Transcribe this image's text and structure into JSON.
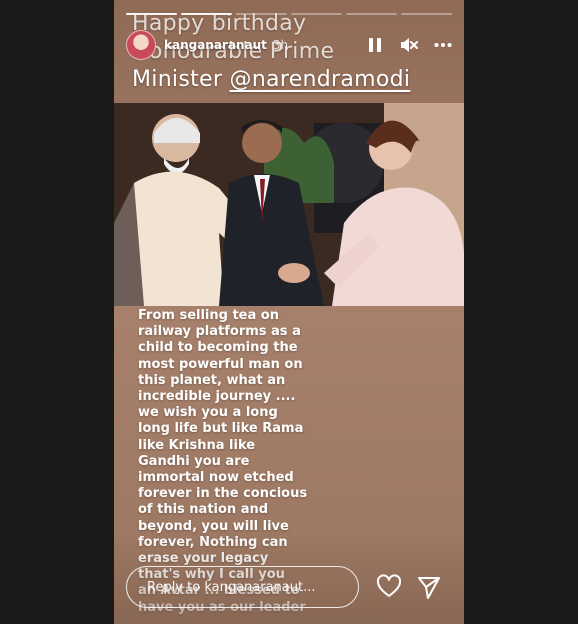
{
  "story": {
    "progress_segments": 6,
    "active_segment": 0,
    "title_lines": [
      "Happy birthday",
      "Honourable Prime",
      "Minister "
    ],
    "title_mention": "@narendramodi",
    "body_text": "From selling tea on\nrailway platforms as a\nchild to becoming the\nmost powerful man on\nthis planet, what an\nincredible journey ....\nwe wish you a long\nlong life but like Rama\nlike Krishna like\nGandhi you are\nimmortal now etched\nforever in the concious\nof this nation and\nbeyond, you will live\nforever, Nothing can\nerase your legacy\nthat's why I call you\nan Avtar ... blessed to\nhave you as our leader"
  },
  "header": {
    "username": "kanganaranaut",
    "time": "3h",
    "avatar_icon": "profile-avatar",
    "pause_icon": "pause-icon",
    "mute_icon": "muted-speaker-icon",
    "more_icon": "more-dots-icon"
  },
  "reply": {
    "placeholder": "Reply to kanganaranaut..."
  },
  "actions": {
    "like_icon": "heart-icon",
    "share_icon": "send-icon"
  }
}
